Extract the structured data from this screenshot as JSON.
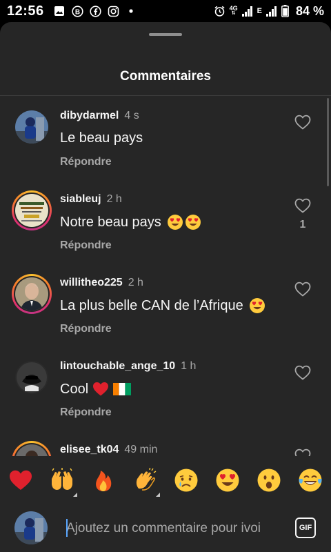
{
  "status_bar": {
    "time": "12:56",
    "network_top": "4G",
    "network_bottom": "E",
    "battery": "84 %",
    "icons": [
      "gallery-icon",
      "b-app-icon",
      "facebook-icon",
      "instagram-icon",
      "dot-icon",
      "alarm-icon",
      "signal-icon",
      "battery-icon"
    ]
  },
  "sheet": {
    "title": "Commentaires"
  },
  "comments": [
    {
      "user": "dibydarmel",
      "time": "4 s",
      "text": "Le beau pays",
      "emojis": [],
      "reply": "Répondre",
      "likes": "",
      "ring": false
    },
    {
      "user": "siableuj",
      "time": "2 h",
      "text": "Notre beau pays",
      "emojis": [
        "heart-eyes",
        "heart-eyes"
      ],
      "reply": "Répondre",
      "likes": "1",
      "ring": true
    },
    {
      "user": "willitheo225",
      "time": "2 h",
      "text": "La plus belle CAN de l’Afrique",
      "emojis": [
        "heart-eyes"
      ],
      "reply": "Répondre",
      "likes": "",
      "ring": true
    },
    {
      "user": "lintouchable_ange_10",
      "time": "1 h",
      "text": "Cool",
      "emojis": [
        "red-heart",
        "ivory-coast-flag"
      ],
      "reply": "Répondre",
      "likes": "",
      "ring": false
    },
    {
      "user": "elisee_tk04",
      "time": "49 min",
      "text": "",
      "emojis": [],
      "reply": "",
      "likes": "",
      "ring": true
    }
  ],
  "reactions": [
    "red-heart",
    "raising-hands",
    "fire",
    "clapping-hands",
    "crying-face",
    "heart-eyes",
    "astonished-face",
    "tears-of-joy"
  ],
  "input": {
    "placeholder": "Ajoutez un commentaire pour ivoi",
    "gif_label": "GIF"
  },
  "colors": {
    "sheet_bg": "#262626",
    "secondary_text": "#a8a8a8",
    "heart_red": "#e0212d",
    "story_ring": "#e1306c"
  }
}
